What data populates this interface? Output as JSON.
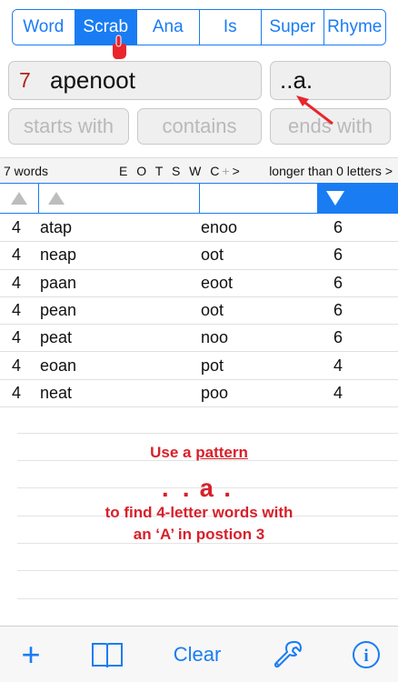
{
  "tabs": [
    "Word",
    "Scrab",
    "Ana",
    "Is",
    "Super",
    "Rhyme"
  ],
  "active_tab": "Scrab",
  "word_input": {
    "count": "7",
    "value": "apenoot"
  },
  "pattern_input": {
    "value": "..a."
  },
  "filters": {
    "starts_placeholder": "starts with",
    "contains_placeholder": "contains",
    "ends_placeholder": "ends with"
  },
  "info_bar": {
    "count": "7 words",
    "letters": "E O T S W C",
    "plus": "+",
    "chevron": ">",
    "length_filter": "longer than 0 letters >"
  },
  "results": [
    {
      "len": "4",
      "word": "atap",
      "remaining": "enoo",
      "score": "6"
    },
    {
      "len": "4",
      "word": "neap",
      "remaining": "oot",
      "score": "6"
    },
    {
      "len": "4",
      "word": "paan",
      "remaining": "eoot",
      "score": "6"
    },
    {
      "len": "4",
      "word": "pean",
      "remaining": "oot",
      "score": "6"
    },
    {
      "len": "4",
      "word": "peat",
      "remaining": "noo",
      "score": "6"
    },
    {
      "len": "4",
      "word": "eoan",
      "remaining": "pot",
      "score": "4"
    },
    {
      "len": "4",
      "word": "neat",
      "remaining": "poo",
      "score": "4"
    }
  ],
  "promo": {
    "line1_prefix": "Use a ",
    "line1_link": "pattern",
    "pattern": "..a.",
    "line3": "to find 4-letter words with",
    "line4": "an ‘A’ in postion 3"
  },
  "toolbar": {
    "add_label": "+",
    "clear_label": "Clear",
    "info_label": "i"
  },
  "colors": {
    "accent": "#1a7cf3",
    "annotation": "#d8202a",
    "count": "#b0241d"
  }
}
